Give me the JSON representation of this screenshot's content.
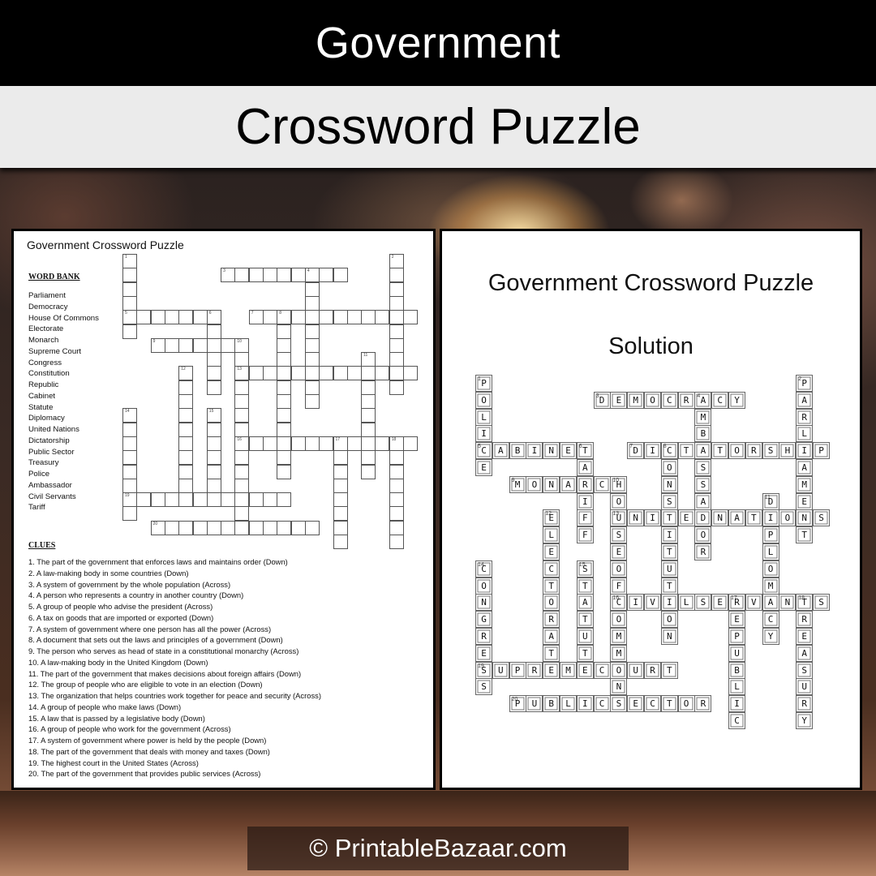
{
  "header": {
    "title": "Government",
    "subtitle": "Crossword Puzzle"
  },
  "puzzle_sheet": {
    "title": "Government Crossword Puzzle",
    "word_bank_heading": "WORD BANK",
    "word_bank": [
      "Parliament",
      "Democracy",
      "House Of Commons",
      "Electorate",
      "Monarch",
      "Supreme  Court",
      "Congress",
      "Constitution",
      "Republic",
      "Cabinet",
      "Statute",
      "Diplomacy",
      "United Nations",
      "Dictatorship",
      "Public Sector",
      "Treasury",
      "Police",
      "Ambassador",
      "Civil Servants",
      "Tariff"
    ],
    "clues_heading": "CLUES",
    "clues": [
      "1. The part of the government  that enforces laws and maintains order  (Down)",
      "2. A law-making body in some countries (Down)",
      "3. A system of government  by the whole population  (Across)",
      "4. A person who represents a country  in another  country (Down)",
      "5. A group of people  who advise the president (Across)",
      "6. A tax on goods that are imported  or exported  (Down)",
      "7. A system of government  where  one person has all the power (Across)",
      "8. A document  that sets out the laws and principles of a government  (Down)",
      "9. The person who serves as head of state in a constitutional monarchy (Across)",
      "10. A law-making body in the  United Kingdom (Down)",
      "11. The part of the government  that makes decisions about foreign affairs (Down)",
      "12. The group of people  who are eligible to vote in an election (Down)",
      "13. The organization that helps countries work together for peace and security (Across)",
      "14. A group of people who make laws (Down)",
      "15. A law that is passed by a legislative body (Down)",
      "16. A group of people who work for the government  (Across)",
      "17. A system of government  where power  is held by the people (Down)",
      "18. The part of the government that deals with money and taxes (Down)",
      "19. The highest court in the United States (Across)",
      "20. The part of the government that provides public services (Across)"
    ]
  },
  "solution_sheet": {
    "title": "Government Crossword Puzzle",
    "subtitle": "Solution"
  },
  "grid": {
    "words": [
      {
        "num": 1,
        "dir": "down",
        "row": 0,
        "col": 0,
        "answer": "POLICE"
      },
      {
        "num": 2,
        "dir": "down",
        "row": 0,
        "col": 19,
        "answer": "PARLIAMENT"
      },
      {
        "num": 3,
        "dir": "across",
        "row": 1,
        "col": 7,
        "answer": "DEMOCRACY"
      },
      {
        "num": 4,
        "dir": "down",
        "row": 1,
        "col": 13,
        "answer": "AMBASSADOR"
      },
      {
        "num": 5,
        "dir": "across",
        "row": 4,
        "col": 0,
        "answer": "CABINET"
      },
      {
        "num": 6,
        "dir": "down",
        "row": 4,
        "col": 6,
        "answer": "TARIFF"
      },
      {
        "num": 7,
        "dir": "across",
        "row": 4,
        "col": 9,
        "answer": "DICTATORSHIP"
      },
      {
        "num": 8,
        "dir": "down",
        "row": 4,
        "col": 11,
        "answer": "CONSTITUTION"
      },
      {
        "num": 9,
        "dir": "across",
        "row": 6,
        "col": 2,
        "answer": "MONARCH"
      },
      {
        "num": 10,
        "dir": "down",
        "row": 6,
        "col": 8,
        "answer": "HOUSEOFCOMMONS"
      },
      {
        "num": 11,
        "dir": "down",
        "row": 7,
        "col": 17,
        "answer": "DIPLOMACY"
      },
      {
        "num": 12,
        "dir": "down",
        "row": 8,
        "col": 4,
        "answer": "ELECTORATE"
      },
      {
        "num": 13,
        "dir": "across",
        "row": 8,
        "col": 8,
        "answer": "UNITEDNATIONS"
      },
      {
        "num": 14,
        "dir": "down",
        "row": 11,
        "col": 0,
        "answer": "CONGRESS"
      },
      {
        "num": 15,
        "dir": "down",
        "row": 11,
        "col": 6,
        "answer": "STATUTE"
      },
      {
        "num": 16,
        "dir": "across",
        "row": 13,
        "col": 8,
        "answer": "CIVILSERVANTS"
      },
      {
        "num": 17,
        "dir": "down",
        "row": 13,
        "col": 15,
        "answer": "REPUBLIC"
      },
      {
        "num": 18,
        "dir": "down",
        "row": 13,
        "col": 19,
        "answer": "TREASURY"
      },
      {
        "num": 19,
        "dir": "across",
        "row": 17,
        "col": 0,
        "answer": "SUPREMECOURT"
      },
      {
        "num": 20,
        "dir": "across",
        "row": 19,
        "col": 2,
        "answer": "PUBLICSECTOR"
      }
    ]
  },
  "footer": {
    "copyright": "© PrintableBazaar.com"
  }
}
